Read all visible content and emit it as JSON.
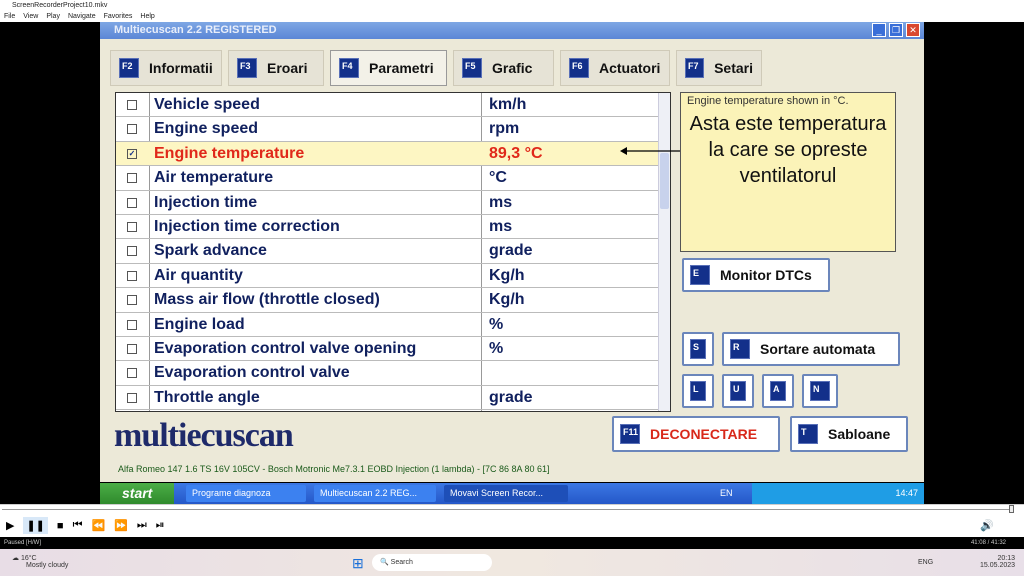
{
  "player": {
    "title": "ScreenRecorderProject10.mkv",
    "menu": [
      "File",
      "View",
      "Play",
      "Navigate",
      "Favorites",
      "Help"
    ],
    "status": "Paused [H/W]",
    "time": "41:08 / 41:32"
  },
  "app": {
    "title": "Multiecuscan 2.2 REGISTERED",
    "tabs": [
      {
        "key": "F2",
        "label": "Informatii"
      },
      {
        "key": "F3",
        "label": "Eroari"
      },
      {
        "key": "F4",
        "label": "Parametri",
        "active": true
      },
      {
        "key": "F5",
        "label": "Grafic"
      },
      {
        "key": "F6",
        "label": "Actuatori"
      },
      {
        "key": "F7",
        "label": "Setari"
      }
    ],
    "params": [
      {
        "name": "Vehicle speed",
        "value": "km/h",
        "checked": false
      },
      {
        "name": "Engine speed",
        "value": "rpm",
        "checked": false
      },
      {
        "name": "Engine temperature",
        "value": "89,3 °C",
        "checked": true
      },
      {
        "name": "Air temperature",
        "value": "°C",
        "checked": false
      },
      {
        "name": "Injection time",
        "value": "ms",
        "checked": false
      },
      {
        "name": "Injection time correction",
        "value": "ms",
        "checked": false
      },
      {
        "name": "Spark advance",
        "value": "grade",
        "checked": false
      },
      {
        "name": "Air quantity",
        "value": "Kg/h",
        "checked": false
      },
      {
        "name": "Mass air flow (throttle closed)",
        "value": "Kg/h",
        "checked": false
      },
      {
        "name": "Engine load",
        "value": "%",
        "checked": false
      },
      {
        "name": "Evaporation control valve opening",
        "value": "%",
        "checked": false
      },
      {
        "name": "Evaporation control valve",
        "value": "",
        "checked": false
      },
      {
        "name": "Throttle angle",
        "value": "grade",
        "checked": false
      }
    ],
    "info_header": "Engine temperature shown in °C.",
    "info_message": "Asta este temperatura la care se opreste ventilatorul",
    "buttons": {
      "monitor_key": "E",
      "monitor": "Monitor DTCs",
      "s_key": "S",
      "r_key": "R",
      "sort": "Sortare automata",
      "l": "L",
      "u": "U",
      "a": "A",
      "n": "N",
      "disc_key": "F11",
      "disconnect": "DECONECTARE",
      "t_key": "T",
      "templates": "Sabloane"
    },
    "logo": "multiecuscan",
    "status": "Alfa Romeo 147 1.6 TS 16V 105CV - Bosch Motronic Me7.3.1 EOBD Injection (1 lambda) - [7C 86 8A 80 61]"
  },
  "xp_taskbar": {
    "start": "start",
    "items": [
      "Programe diagnoza",
      "Multiecuscan 2.2 REG...",
      "Movavi Screen Recor..."
    ],
    "lang": "EN",
    "clock": "14:47"
  },
  "win11": {
    "temp": "16°C",
    "weather": "Mostly cloudy",
    "search": "Search",
    "lang": "ENG",
    "time": "20:13",
    "date": "15.05.2023"
  }
}
